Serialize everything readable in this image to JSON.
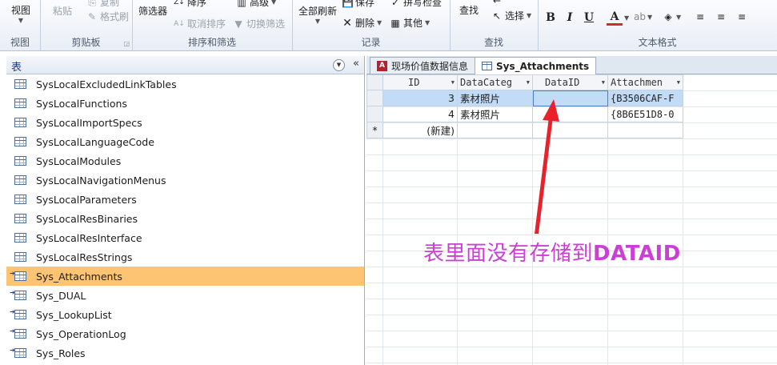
{
  "ribbon": {
    "groups": {
      "view": {
        "button": "视图",
        "label": "视图"
      },
      "clipboard": {
        "paste": "粘贴",
        "copy": "复制",
        "format_painter": "格式刷",
        "label": "剪贴板"
      },
      "sort_filter": {
        "filter": "筛选器",
        "descending": "降序",
        "remove_sort": "取消排序",
        "advanced": "高级",
        "toggle_filter": "切换筛选",
        "label": "排序和筛选"
      },
      "records": {
        "refresh_all": "全部刷新",
        "save": "保存",
        "spelling": "拼写检查",
        "delete": "删除",
        "more": "其他",
        "label": "记录"
      },
      "find": {
        "find": "查找",
        "select": "选择",
        "label": "查找"
      },
      "text_format": {
        "bold": "B",
        "italic": "I",
        "underline": "U",
        "font_color": "A",
        "label": "文本格式"
      }
    }
  },
  "nav": {
    "title": "表",
    "items": [
      {
        "label": "SysLocalExcludedLinkTables",
        "linked": false,
        "selected": false
      },
      {
        "label": "SysLocalFunctions",
        "linked": false,
        "selected": false
      },
      {
        "label": "SysLocalImportSpecs",
        "linked": false,
        "selected": false
      },
      {
        "label": "SysLocalLanguageCode",
        "linked": false,
        "selected": false
      },
      {
        "label": "SysLocalModules",
        "linked": false,
        "selected": false
      },
      {
        "label": "SysLocalNavigationMenus",
        "linked": false,
        "selected": false
      },
      {
        "label": "SysLocalParameters",
        "linked": false,
        "selected": false
      },
      {
        "label": "SysLocalResBinaries",
        "linked": false,
        "selected": false
      },
      {
        "label": "SysLocalResInterface",
        "linked": false,
        "selected": false
      },
      {
        "label": "SysLocalResStrings",
        "linked": false,
        "selected": false
      },
      {
        "label": "Sys_Attachments",
        "linked": true,
        "selected": true
      },
      {
        "label": "Sys_DUAL",
        "linked": true,
        "selected": false
      },
      {
        "label": "Sys_LookupList",
        "linked": true,
        "selected": false
      },
      {
        "label": "Sys_OperationLog",
        "linked": true,
        "selected": false
      },
      {
        "label": "Sys_Roles",
        "linked": true,
        "selected": false
      }
    ]
  },
  "tabs": [
    {
      "label": "现场价值数据信息",
      "icon": "report-icon",
      "active": false
    },
    {
      "label": "Sys_Attachments",
      "icon": "table-icon",
      "active": true
    }
  ],
  "datasheet": {
    "columns": [
      "ID",
      "DataCateg",
      "DataID",
      "Attachmen"
    ],
    "rows": [
      {
        "id": "3",
        "category": "素材照片",
        "data_id": "",
        "attachment": "{B3506CAF-F"
      },
      {
        "id": "4",
        "category": "素材照片",
        "data_id": "",
        "attachment": "{8B6E51D8-0"
      }
    ],
    "new_row_marker": "*",
    "new_row_label": "(新建)"
  },
  "annotation": {
    "prefix": "表里面没有存储到",
    "highlight": "DATAID",
    "color": "#cc3fd4"
  }
}
